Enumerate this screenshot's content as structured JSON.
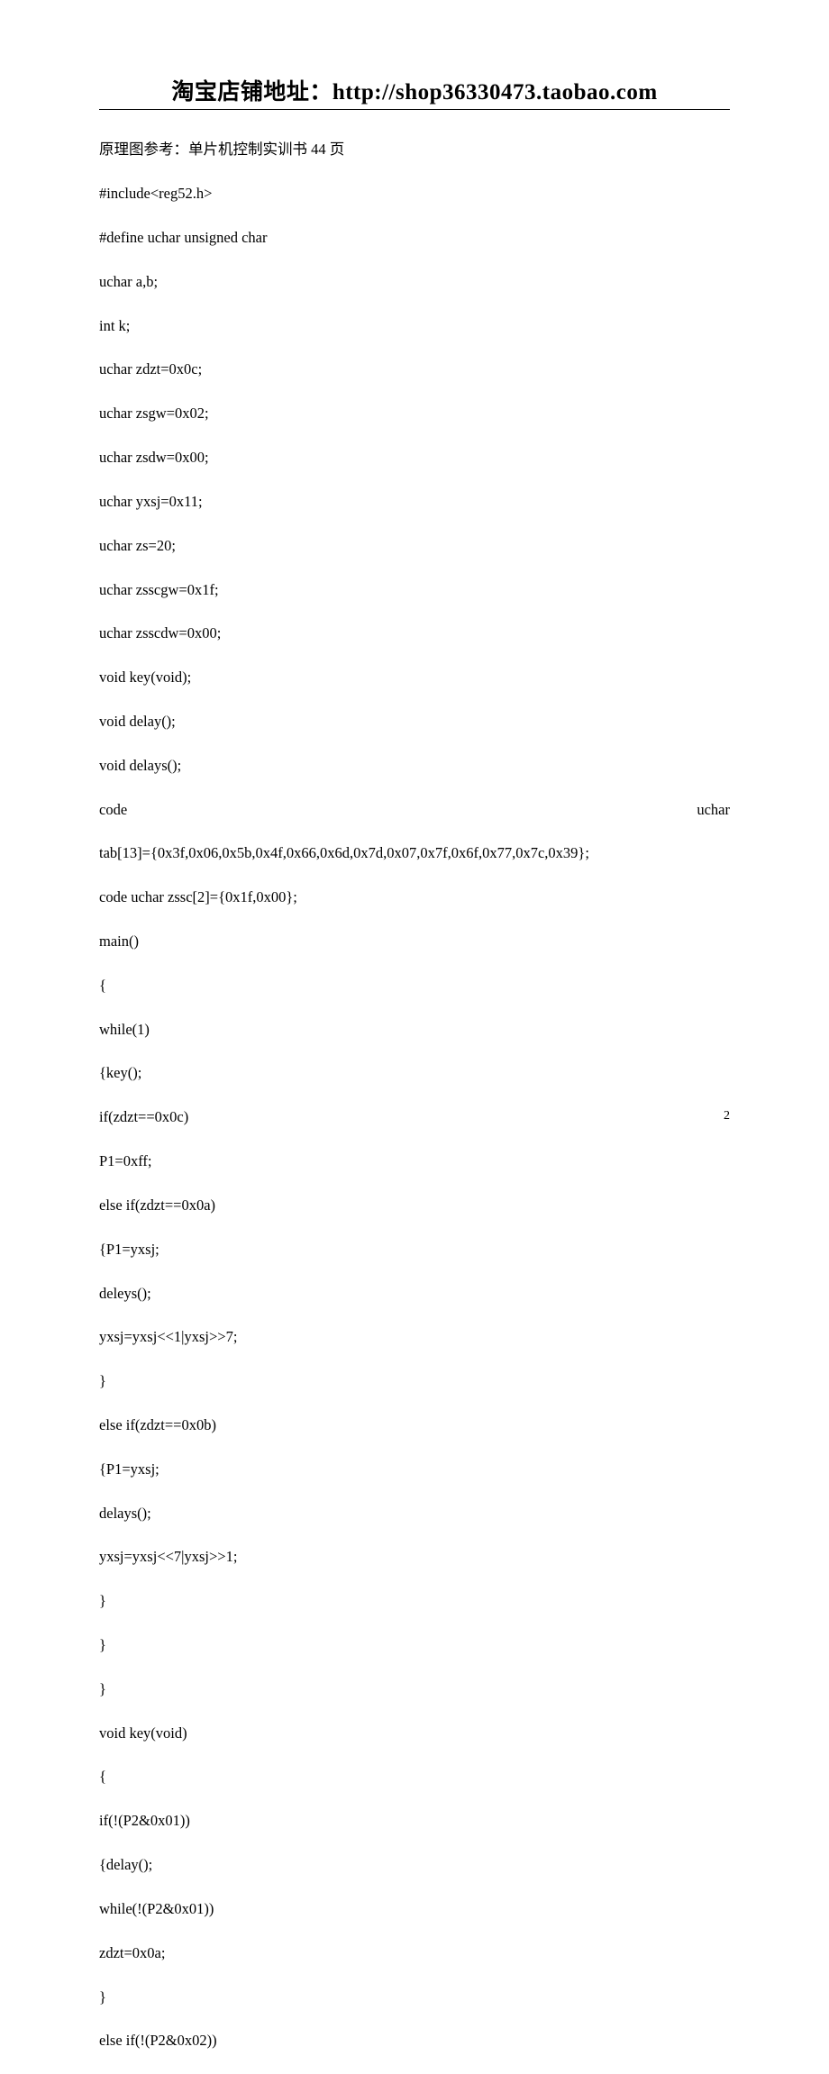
{
  "header": {
    "title": "淘宝店铺地址：http://shop36330473.taobao.com"
  },
  "code": {
    "line01": "原理图参考：单片机控制实训书 44 页",
    "line02": "#include<reg52.h>",
    "line03": "#define uchar unsigned char",
    "line04": "uchar a,b;",
    "line05": "int k;",
    "line06": "uchar zdzt=0x0c;",
    "line07": "uchar zsgw=0x02;",
    "line08": "uchar zsdw=0x00;",
    "line09": "uchar yxsj=0x11;",
    "line10": "uchar zs=20;",
    "line11": "uchar zsscgw=0x1f;",
    "line12": "uchar zsscdw=0x00;",
    "line13": "void key(void);",
    "line14": "void delay();",
    "line15": "void delays();",
    "line16a": "code",
    "line16b": "uchar",
    "line17": "tab[13]={0x3f,0x06,0x5b,0x4f,0x66,0x6d,0x7d,0x07,0x7f,0x6f,0x77,0x7c,0x39};",
    "line18": "code uchar zssc[2]={0x1f,0x00};",
    "line19": "main()",
    "line20": "{",
    "line21": "while(1)",
    "line22": "{key();",
    "line23": "if(zdzt==0x0c)",
    "line24": "P1=0xff;",
    "line25": "else if(zdzt==0x0a)",
    "line26": "{P1=yxsj;",
    "line27": "deleys();",
    "line28": "yxsj=yxsj<<1|yxsj>>7;",
    "line29": "}",
    "line30": "else if(zdzt==0x0b)",
    "line31": "{P1=yxsj;",
    "line32": "delays();",
    "line33": "yxsj=yxsj<<7|yxsj>>1;",
    "line34": "}",
    "line35": "}",
    "line36": "}",
    "line37": "void key(void)",
    "line38": "{",
    "line39": "if(!(P2&0x01))",
    "line40": "{delay();",
    "line41": "while(!(P2&0x01))",
    "line42": "zdzt=0x0a;",
    "line43": "}",
    "line44": "else if(!(P2&0x02))"
  },
  "footer": {
    "page_number": "2"
  }
}
